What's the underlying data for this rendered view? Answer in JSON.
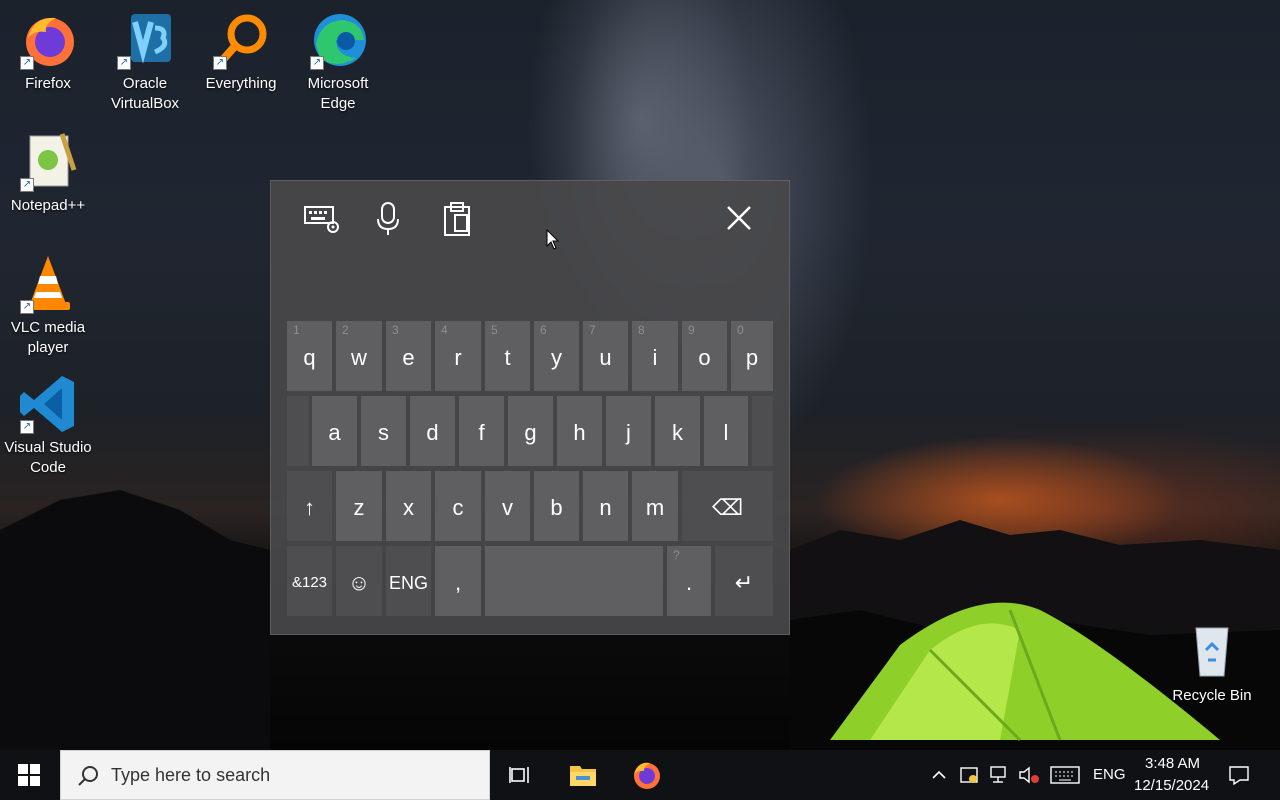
{
  "desktop": {
    "icons": [
      {
        "label": "Firefox",
        "icon": "firefox-icon"
      },
      {
        "label": "Oracle VirtualBox",
        "icon": "virtualbox-icon"
      },
      {
        "label": "Everything",
        "icon": "everything-icon"
      },
      {
        "label": "Microsoft Edge",
        "icon": "edge-icon"
      },
      {
        "label": "Notepad++",
        "icon": "notepadpp-icon"
      },
      {
        "label": "VLC media player",
        "icon": "vlc-icon"
      },
      {
        "label": "Visual Studio Code",
        "icon": "vscode-icon"
      },
      {
        "label": "Recycle Bin",
        "icon": "recycle-bin-icon"
      }
    ]
  },
  "keyboard": {
    "toolbar": {
      "settings_icon": "keyboard-settings-icon",
      "mic_icon": "microphone-icon",
      "clipboard_icon": "clipboard-icon",
      "close_icon": "close-icon"
    },
    "row1": [
      {
        "key": "q",
        "num": "1"
      },
      {
        "key": "w",
        "num": "2"
      },
      {
        "key": "e",
        "num": "3"
      },
      {
        "key": "r",
        "num": "4"
      },
      {
        "key": "t",
        "num": "5"
      },
      {
        "key": "y",
        "num": "6"
      },
      {
        "key": "u",
        "num": "7"
      },
      {
        "key": "i",
        "num": "8"
      },
      {
        "key": "o",
        "num": "9"
      },
      {
        "key": "p",
        "num": "0"
      }
    ],
    "row2": [
      "a",
      "s",
      "d",
      "f",
      "g",
      "h",
      "j",
      "k",
      "l"
    ],
    "row3": {
      "shift": "↑",
      "keys": [
        "z",
        "x",
        "c",
        "v",
        "b",
        "n",
        "m"
      ],
      "backspace": "⌫"
    },
    "row4": {
      "symbols": "&123",
      "emoji": "☺",
      "lang": "ENG",
      "comma": ",",
      "period": ".",
      "period_hint": "?",
      "enter": "↵"
    }
  },
  "taskbar": {
    "search_placeholder": "Type here to search",
    "pinned": [
      "task-view-icon",
      "file-explorer-icon",
      "firefox-icon"
    ],
    "tray": {
      "language": "ENG",
      "time": "3:48 AM",
      "date": "12/15/2024"
    }
  },
  "colors": {
    "keyboard_bg": "#48484a",
    "key_bg": "#5f5f61",
    "key_dark_bg": "#4e4e50",
    "taskbar_bg": "#101114",
    "search_bg": "#f3f3f3"
  }
}
